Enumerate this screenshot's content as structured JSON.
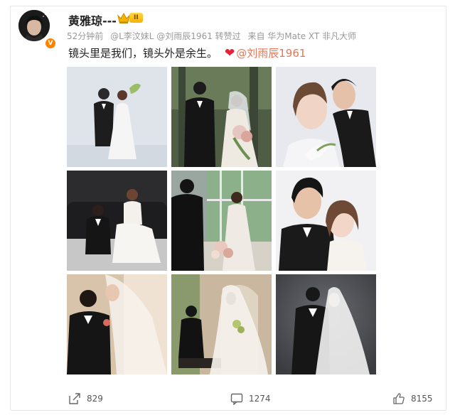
{
  "user": {
    "name": "黄雅琼---",
    "vip_level": "II",
    "verified_badge": "V"
  },
  "meta": {
    "time": "52分钟前",
    "mentions": "@L李汶妹L @刘雨辰1961 转赞过",
    "source": "来自 华为Mate XT 非凡大师"
  },
  "post": {
    "text": "镜头里是我们，镜头外是余生。",
    "heart": "❤",
    "mention": "@刘雨辰1961"
  },
  "photos": [
    {
      "name": "photo-1",
      "theme": "light-studio"
    },
    {
      "name": "photo-2",
      "theme": "garden-bouquet"
    },
    {
      "name": "photo-3",
      "theme": "close-up-white"
    },
    {
      "name": "photo-4",
      "theme": "sofa-dark"
    },
    {
      "name": "photo-5",
      "theme": "window-greenhouse"
    },
    {
      "name": "photo-6",
      "theme": "close-up-faces"
    },
    {
      "name": "photo-7",
      "theme": "warm-veil"
    },
    {
      "name": "photo-8",
      "theme": "arch-veil"
    },
    {
      "name": "photo-9",
      "theme": "dark-veil"
    }
  ],
  "footer": {
    "share_count": "829",
    "comment_count": "1274",
    "like_count": "8155"
  },
  "icons": {
    "share": "share-icon",
    "comment": "comment-icon",
    "like": "thumbs-up-icon"
  },
  "colors": {
    "accent": "#eb7350",
    "heart": "#e8203a",
    "muted": "#999999"
  }
}
